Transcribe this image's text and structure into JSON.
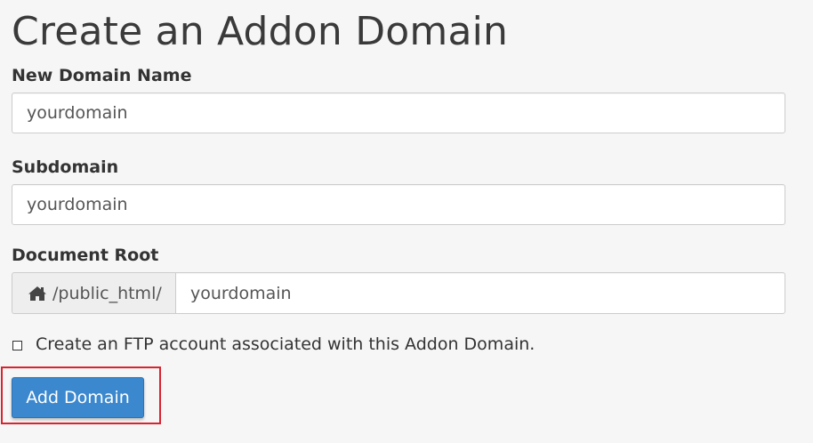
{
  "page": {
    "title": "Create an Addon Domain"
  },
  "form": {
    "new_domain": {
      "label": "New Domain Name",
      "value": "yourdomain"
    },
    "subdomain": {
      "label": "Subdomain",
      "value": "yourdomain"
    },
    "document_root": {
      "label": "Document Root",
      "prefix_icon": "home-icon",
      "prefix": "/public_html/",
      "value": "yourdomain"
    },
    "ftp_checkbox": {
      "label": "Create an FTP account associated with this Addon Domain.",
      "checked": false
    },
    "submit": {
      "label": "Add Domain"
    }
  },
  "colors": {
    "background": "#f6f6f6",
    "primary_button": "#3b88cf",
    "highlight_border": "#d9232f"
  }
}
